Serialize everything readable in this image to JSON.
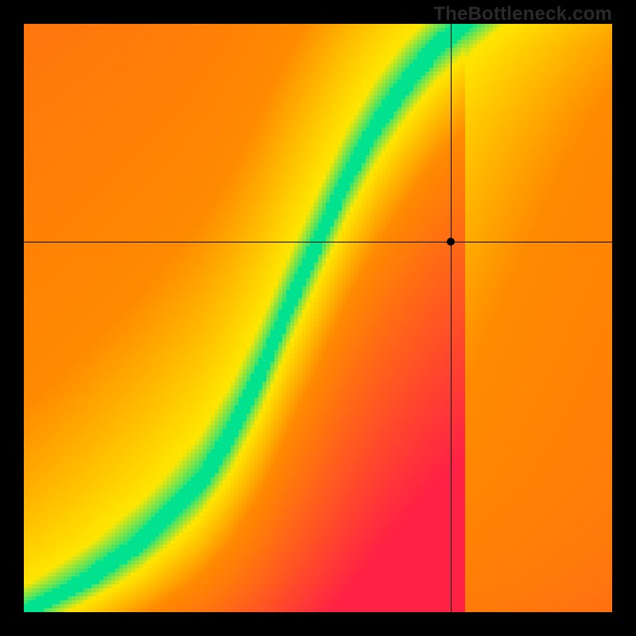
{
  "attribution": "TheBottleneck.com",
  "colors": {
    "red": "#ff2244",
    "orange": "#ff8a00",
    "yellow": "#ffe600",
    "green": "#00e28e",
    "background": "#000000"
  },
  "chart_data": {
    "type": "heatmap",
    "title": "",
    "xlabel": "",
    "ylabel": "",
    "xlim": [
      0,
      1
    ],
    "ylim": [
      0,
      1
    ],
    "grid": false,
    "legend": "none",
    "crosshair": {
      "x": 0.725,
      "y": 0.63
    },
    "marker": {
      "x": 0.725,
      "y": 0.63
    },
    "ridge": {
      "description": "green optimal band center as y=f(x)",
      "points": [
        {
          "x": 0.0,
          "y": 0.0
        },
        {
          "x": 0.1,
          "y": 0.05
        },
        {
          "x": 0.2,
          "y": 0.12
        },
        {
          "x": 0.3,
          "y": 0.22
        },
        {
          "x": 0.35,
          "y": 0.3
        },
        {
          "x": 0.4,
          "y": 0.4
        },
        {
          "x": 0.45,
          "y": 0.52
        },
        {
          "x": 0.5,
          "y": 0.63
        },
        {
          "x": 0.55,
          "y": 0.74
        },
        {
          "x": 0.6,
          "y": 0.83
        },
        {
          "x": 0.65,
          "y": 0.9
        },
        {
          "x": 0.7,
          "y": 0.96
        },
        {
          "x": 0.75,
          "y": 1.0
        }
      ],
      "half_width": 0.035
    },
    "color_scale": {
      "stops": [
        {
          "d": 0.0,
          "color": "green"
        },
        {
          "d": 0.06,
          "color": "yellow"
        },
        {
          "d": 0.25,
          "color": "orange"
        },
        {
          "d": 0.7,
          "color": "red"
        }
      ],
      "asymmetry_note": "regions above the ridge decay toward yellow/orange; regions below decay faster toward red"
    }
  }
}
